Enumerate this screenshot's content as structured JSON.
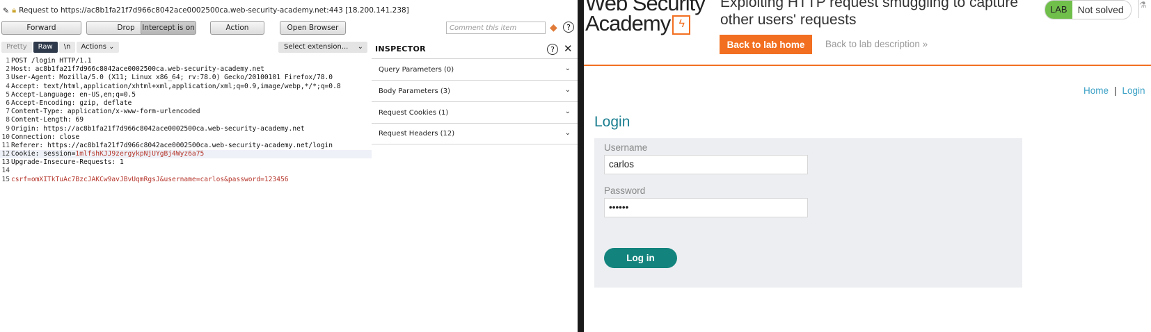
{
  "burp": {
    "request_line": "Request to https://ac8b1fa21f7d966c8042ace0002500ca.web-security-academy.net:443  [18.200.141.238]",
    "buttons": {
      "forward": "Forward",
      "drop": "Drop",
      "intercept": "Intercept is on",
      "action": "Action",
      "open_browser": "Open Browser"
    },
    "comment_placeholder": "Comment this item",
    "editor_tabs": {
      "pretty": "Pretty",
      "raw": "Raw",
      "newline": "\\n",
      "actions": "Actions ⌄"
    },
    "select_extension": "Select extension...",
    "lines": [
      {
        "n": "1",
        "t": "POST /login HTTP/1.1"
      },
      {
        "n": "2",
        "t": "Host: ac8b1fa21f7d966c8042ace0002500ca.web-security-academy.net"
      },
      {
        "n": "3",
        "t": "User-Agent: Mozilla/5.0 (X11; Linux x86_64; rv:78.0) Gecko/20100101 Firefox/78.0"
      },
      {
        "n": "4",
        "t": "Accept: text/html,application/xhtml+xml,application/xml;q=0.9,image/webp,*/*;q=0.8"
      },
      {
        "n": "5",
        "t": "Accept-Language: en-US,en;q=0.5"
      },
      {
        "n": "6",
        "t": "Accept-Encoding: gzip, deflate"
      },
      {
        "n": "7",
        "t": "Content-Type: application/x-www-form-urlencoded"
      },
      {
        "n": "8",
        "t": "Content-Length: 69"
      },
      {
        "n": "9",
        "t": "Origin: https://ac8b1fa21f7d966c8042ace0002500ca.web-security-academy.net"
      },
      {
        "n": "10",
        "t": "Connection: close"
      },
      {
        "n": "11",
        "t": "Referer: https://ac8b1fa21f7d966c8042ace0002500ca.web-security-academy.net/login"
      },
      {
        "n": "12",
        "t": "Cookie: session=",
        "red": "1mlfshKJJ9zergykpNjUYgBj4Wyz6a75"
      },
      {
        "n": "13",
        "t": "Upgrade-Insecure-Requests: 1"
      },
      {
        "n": "14",
        "t": ""
      },
      {
        "n": "15",
        "t": "",
        "red": "csrf=omXITkTuAc7BzcJAKCw9avJBvUqmRgsJ&username=carlos&password=123456"
      }
    ],
    "inspector": {
      "title": "INSPECTOR",
      "sections": [
        "Query Parameters (0)",
        "Body Parameters (3)",
        "Request Cookies (1)",
        "Request Headers (12)"
      ]
    }
  },
  "web": {
    "logo_line1": "Web Security",
    "logo_line2": "Academy",
    "lab_title_line1": "Exploiting HTTP request smuggling to capture",
    "lab_title_line2": "other users' requests",
    "lab_badge": "LAB",
    "lab_status": "Not solved",
    "back_home": "Back to lab home",
    "back_desc": "Back to lab description »",
    "nav_home": "Home",
    "nav_sep": "|",
    "nav_login": "Login",
    "login_heading": "Login",
    "username_label": "Username",
    "username_value": "carlos",
    "password_label": "Password",
    "password_value": "••••••",
    "login_button": "Log in"
  },
  "colors": {
    "accent_orange": "#f26f21",
    "teal": "#13847d",
    "link_blue": "#3aa0c5"
  },
  "icons": [
    "pencil-icon",
    "lock-icon",
    "highlight-icon",
    "help-icon",
    "close-icon",
    "chevron-down-icon",
    "flask-icon"
  ]
}
